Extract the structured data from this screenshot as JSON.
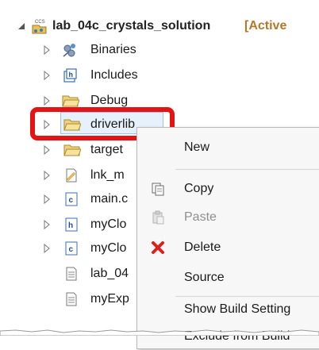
{
  "project": {
    "name": "lab_04c_crystals_solution",
    "decoration": "[Active"
  },
  "tree": {
    "items": [
      {
        "label": "Binaries",
        "icon": "binaries-icon"
      },
      {
        "label": "Includes",
        "icon": "includes-icon"
      },
      {
        "label": "Debug",
        "icon": "folder-icon"
      },
      {
        "label": "driverlib",
        "icon": "folder-icon"
      },
      {
        "label": "target",
        "icon": "folder-icon"
      },
      {
        "label": "lnk_m",
        "icon": "linker-file-icon"
      },
      {
        "label": "main.c",
        "icon": "c-file-icon"
      },
      {
        "label": "myClo",
        "icon": "h-file-icon"
      },
      {
        "label": "myClo",
        "icon": "c-file-icon"
      },
      {
        "label": "lab_04",
        "icon": "text-file-icon"
      },
      {
        "label": "myExp",
        "icon": "text-file-icon"
      }
    ]
  },
  "context_menu": {
    "new": "New",
    "copy": "Copy",
    "paste": "Paste",
    "delete": "Delete",
    "source": "Source",
    "show_build_settings": "Show Build Setting",
    "exclude_from_build": "Exclude from Build"
  },
  "colors": {
    "highlight": "#e41414",
    "selection": "#e7f1fb",
    "folder": "#e8c15a",
    "delete": "#d9201c"
  }
}
